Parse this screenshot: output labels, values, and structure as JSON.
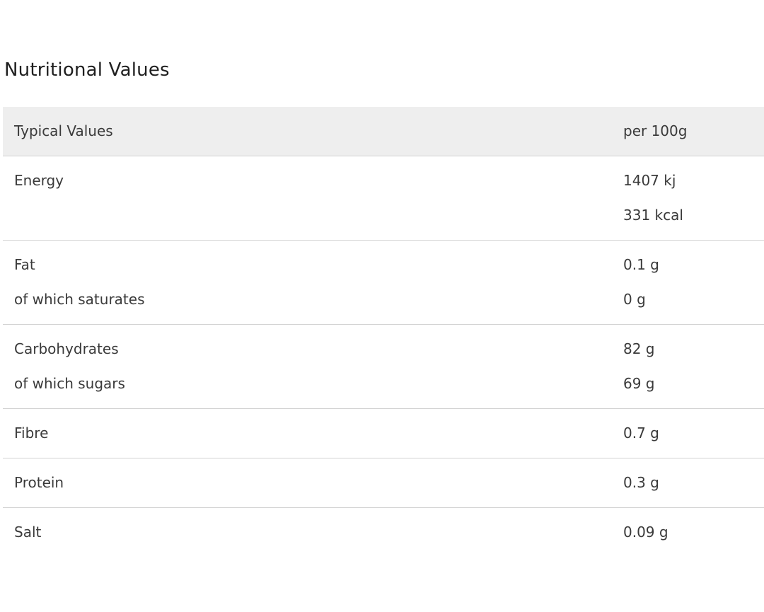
{
  "title": "Nutritional Values",
  "header": {
    "label": "Typical Values",
    "value": "per 100g"
  },
  "rows": [
    {
      "lines": [
        {
          "label": "Energy",
          "value": "1407 kj"
        },
        {
          "label": "",
          "value": "331 kcal"
        }
      ]
    },
    {
      "lines": [
        {
          "label": "Fat",
          "value": "0.1 g"
        },
        {
          "label": "of which saturates",
          "value": "0 g"
        }
      ]
    },
    {
      "lines": [
        {
          "label": "Carbohydrates",
          "value": "82 g"
        },
        {
          "label": "of which sugars",
          "value": "69 g"
        }
      ]
    },
    {
      "lines": [
        {
          "label": "Fibre",
          "value": "0.7 g"
        }
      ]
    },
    {
      "lines": [
        {
          "label": "Protein",
          "value": "0.3 g"
        }
      ]
    },
    {
      "lines": [
        {
          "label": "Salt",
          "value": "0.09 g"
        }
      ]
    }
  ]
}
